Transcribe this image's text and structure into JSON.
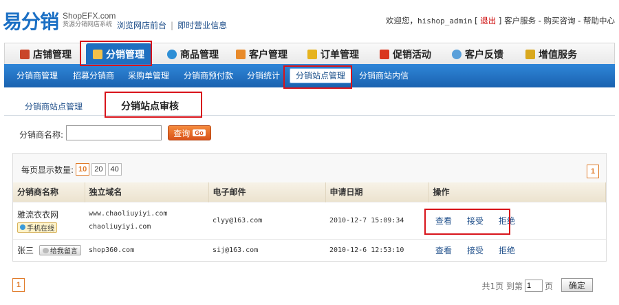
{
  "header": {
    "logo_cn": "易分销",
    "logo_en": "ShopEFX.com",
    "logo_tagline": "货源分销网店系统",
    "links": [
      "浏览网店前台",
      "即时营业信息"
    ],
    "welcome": "欢迎您，",
    "username": "hishop_admin",
    "logout_open": "[",
    "logout": "退出",
    "logout_close": "]",
    "right_links": "客户服务 - 购买咨询 - 帮助中心"
  },
  "main_nav": [
    {
      "label": "店铺管理",
      "icon": "home-icon"
    },
    {
      "label": "分销管理",
      "icon": "distribution-icon",
      "active": true
    },
    {
      "label": "商品管理",
      "icon": "product-icon"
    },
    {
      "label": "客户管理",
      "icon": "customer-icon"
    },
    {
      "label": "订单管理",
      "icon": "order-icon"
    },
    {
      "label": "促销活动",
      "icon": "promotion-icon"
    },
    {
      "label": "客户反馈",
      "icon": "feedback-icon"
    },
    {
      "label": "增值服务",
      "icon": "service-icon"
    }
  ],
  "sub_nav": [
    "分销商管理",
    "招募分销商",
    "采购单管理",
    "分销商预付款",
    "分销统计",
    "分销站点管理",
    "分销商站内信"
  ],
  "tabs": [
    "分销商站点管理",
    "分销站点审核"
  ],
  "search": {
    "label": "分销商名称:",
    "value": "",
    "button": "查询",
    "button_go": "Go"
  },
  "list": {
    "pagesize_label": "每页显示数量:",
    "pagesize_options": [
      "10",
      "20",
      "40"
    ],
    "pagesize_selected": "10",
    "page": "1",
    "columns": [
      "分销商名称",
      "独立域名",
      "电子邮件",
      "申请日期",
      "操作"
    ],
    "rows": [
      {
        "name": "雅流衣衣网",
        "badge": "手机在线",
        "domains": [
          "www.chaoliuyiyi.com",
          "chaoliuyiyi.com"
        ],
        "email": "clyy@163.com",
        "date": "2010-12-7 15:09:34"
      },
      {
        "name": "张三",
        "badge": "给我留言",
        "domains": [
          "shop360.com"
        ],
        "email": "sij@163.com",
        "date": "2010-12-6 12:53:10"
      }
    ],
    "actions": [
      "查看",
      "接受",
      "拒绝"
    ]
  },
  "pager": {
    "page": "1",
    "total_prefix": "共1页",
    "goto_prefix": "到第",
    "goto_value": "1",
    "goto_suffix": "页",
    "confirm": "确定"
  },
  "colors": {
    "primary_blue": "#1e6fc0",
    "highlight_red": "#d8131a",
    "accent_orange": "#e07b2a"
  }
}
